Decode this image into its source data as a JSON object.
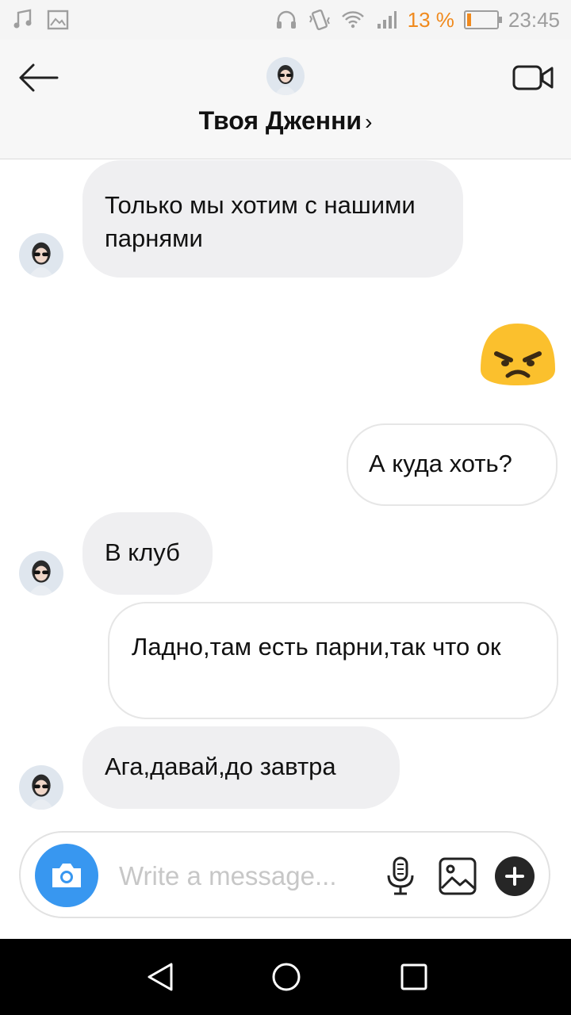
{
  "status_bar": {
    "battery_percent": "13 %",
    "time": "23:45",
    "icons": [
      "music-icon",
      "image-icon",
      "headphones-icon",
      "vibrate-icon",
      "wifi-icon",
      "signal-icon",
      "battery-icon"
    ],
    "battery_color": "#f08a1e"
  },
  "header": {
    "title": "Твоя Дженни",
    "chevron": "›"
  },
  "messages": [
    {
      "side": "in",
      "text": "Только мы хотим с нашими парнями"
    },
    {
      "side": "out",
      "type": "emoji",
      "emoji": "angry-face"
    },
    {
      "side": "out",
      "text": "А куда хоть?"
    },
    {
      "side": "in",
      "text": "В клуб"
    },
    {
      "side": "out",
      "text": "Ладно,там есть парни,так что ок"
    },
    {
      "side": "in",
      "text": "Ага,давай,до завтра"
    }
  ],
  "composer": {
    "placeholder": "Write a message...",
    "accent_color": "#3897f0"
  }
}
